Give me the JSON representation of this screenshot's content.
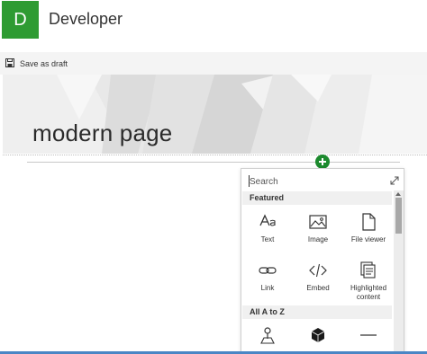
{
  "header": {
    "site_initial": "D",
    "site_title": "Developer"
  },
  "command_bar": {
    "save_draft_label": "Save as draft"
  },
  "page": {
    "title": "modern page"
  },
  "toolbox": {
    "search_placeholder": "Search",
    "featured_label": "Featured",
    "featured_items": [
      {
        "label": "Text",
        "icon": "text-icon"
      },
      {
        "label": "Image",
        "icon": "image-icon"
      },
      {
        "label": "File viewer",
        "icon": "file-viewer-icon"
      },
      {
        "label": "Link",
        "icon": "link-icon"
      },
      {
        "label": "Embed",
        "icon": "embed-icon"
      },
      {
        "label": "Highlighted content",
        "icon": "highlighted-content-icon"
      }
    ],
    "az_label": "All A to Z",
    "az_items": [
      {
        "icon": "map-pin-icon"
      },
      {
        "icon": "cube-icon"
      },
      {
        "icon": "divider-icon"
      }
    ]
  },
  "colors": {
    "brand": "#2e9b32",
    "add_button": "#1c8a2e"
  }
}
